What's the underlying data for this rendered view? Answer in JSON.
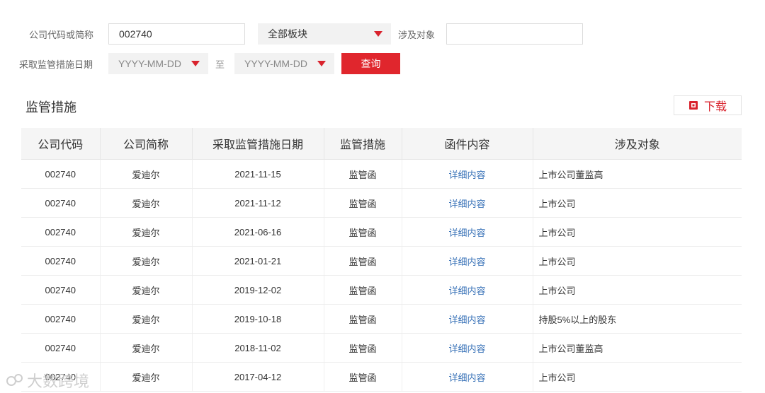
{
  "filters": {
    "company_label": "公司代码或简称",
    "company_value": "002740",
    "board_value": "全部板块",
    "object_label": "涉及对象",
    "object_value": "",
    "date_label": "采取监管措施日期",
    "date_from_placeholder": "YYYY-MM-DD",
    "date_sep": "至",
    "date_to_placeholder": "YYYY-MM-DD",
    "search_label": "查询"
  },
  "section": {
    "title": "监管措施",
    "download_label": "下载"
  },
  "table": {
    "headers": [
      "公司代码",
      "公司简称",
      "采取监管措施日期",
      "监管措施",
      "函件内容",
      "涉及对象"
    ],
    "rows": [
      [
        "002740",
        "爱迪尔",
        "2021-11-15",
        "监管函",
        "详细内容",
        "上市公司董监高"
      ],
      [
        "002740",
        "爱迪尔",
        "2021-11-12",
        "监管函",
        "详细内容",
        "上市公司"
      ],
      [
        "002740",
        "爱迪尔",
        "2021-06-16",
        "监管函",
        "详细内容",
        "上市公司"
      ],
      [
        "002740",
        "爱迪尔",
        "2021-01-21",
        "监管函",
        "详细内容",
        "上市公司"
      ],
      [
        "002740",
        "爱迪尔",
        "2019-12-02",
        "监管函",
        "详细内容",
        "上市公司"
      ],
      [
        "002740",
        "爱迪尔",
        "2019-10-18",
        "监管函",
        "详细内容",
        "持股5%以上的股东"
      ],
      [
        "002740",
        "爱迪尔",
        "2018-11-02",
        "监管函",
        "详细内容",
        "上市公司董监高"
      ],
      [
        "002740",
        "爱迪尔",
        "2017-04-12",
        "监管函",
        "详细内容",
        "上市公司"
      ]
    ]
  },
  "watermark": "大数跨境",
  "colors": {
    "accent_red": "#e0262d",
    "link_blue": "#3a73b8"
  }
}
